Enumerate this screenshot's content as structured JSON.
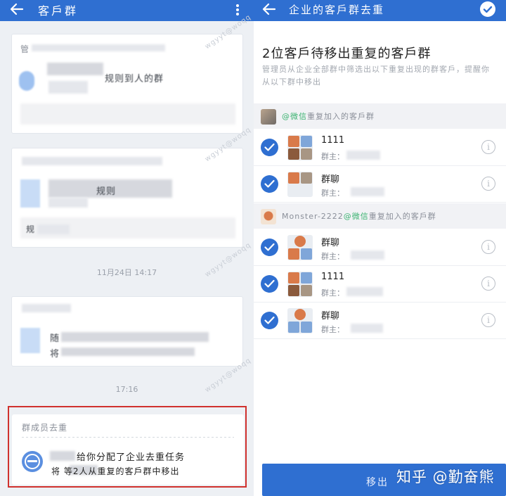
{
  "left": {
    "appbar": {
      "title": "客戶群"
    },
    "card1": {
      "header": "管",
      "line": "规则到人的群"
    },
    "card2": {
      "header": "",
      "line": "规则",
      "footer": "规"
    },
    "timestamp1": "11月24日 14:17",
    "card3": {
      "line1": "随",
      "line2": "将"
    },
    "timestamp2": "17:16",
    "task": {
      "title": "群成员去重",
      "line1": "给你分配了企业去重任务",
      "line2": "将       等2人从重复的客戶群中移出"
    },
    "watermark": "wgyyt@woqq"
  },
  "right": {
    "appbar": {
      "title": "企业的客戶群去重"
    },
    "headline": "2位客戶待移出重复的客戶群",
    "subtext": "管理员从企业全部群中筛选出以下重复出现的群客戶，提醒你从以下群中移出",
    "groups": [
      {
        "prefix": "",
        "accent": "@微信",
        "suffix": "重复加入的客戶群",
        "rows": [
          {
            "name": "1111",
            "owner": "群主："
          },
          {
            "name": "群聊",
            "owner": "群主："
          }
        ]
      },
      {
        "prefix": "Monster-2222",
        "accent": "@微信",
        "suffix": "重复加入的客戶群",
        "rows": [
          {
            "name": "群聊",
            "owner": "群主："
          },
          {
            "name": "1111",
            "owner": "群主："
          },
          {
            "name": "群聊",
            "owner": "群主："
          }
        ]
      }
    ],
    "info_glyph": "i",
    "bottom_button": "移出",
    "watermark": "知乎 @勤奋熊"
  },
  "colors": {
    "brand_blue": "#2f6fd1",
    "highlight_red": "#d0312d",
    "wechat_green": "#3cb371"
  }
}
